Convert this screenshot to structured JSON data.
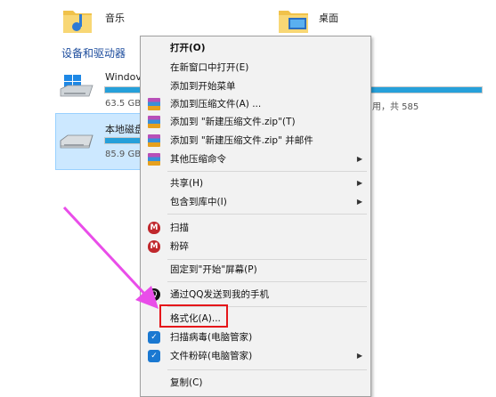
{
  "explorer": {
    "folders": [
      {
        "name": "音乐",
        "icon": "music-folder-icon"
      },
      {
        "name": "桌面",
        "icon": "desktop-folder-icon"
      }
    ],
    "section_title": "设备和驱动器",
    "drives": [
      {
        "name": "Windov",
        "size": "63.5 GB",
        "icon": "windows-drive-icon"
      },
      {
        "name": "本地磁盘",
        "size": "85.9 GB",
        "icon": "hard-drive-icon"
      }
    ],
    "partial_text": "用，共 585"
  },
  "context_menu": {
    "items": [
      {
        "label": "打开(O)",
        "bold": true
      },
      {
        "label": "在新窗口中打开(E)"
      },
      {
        "label": "添加到开始菜单"
      },
      {
        "label": "添加到压缩文件(A) ...",
        "icon": "winrar-icon"
      },
      {
        "label": "添加到 \"新建压缩文件.zip\"(T)",
        "icon": "winrar-icon"
      },
      {
        "label": "添加到 \"新建压缩文件.zip\" 并邮件",
        "icon": "winrar-icon"
      },
      {
        "label": "其他压缩命令",
        "icon": "winrar-icon",
        "submenu": true
      },
      {
        "label": "共享(H)",
        "submenu": true
      },
      {
        "label": "包含到库中(I)",
        "submenu": true
      },
      {
        "label": "扫描",
        "icon": "mcafee-icon"
      },
      {
        "label": "粉碎",
        "icon": "mcafee-icon"
      },
      {
        "label": "固定到\"开始\"屏幕(P)"
      },
      {
        "label": "通过QQ发送到我的手机",
        "icon": "qq-icon"
      },
      {
        "label": "格式化(A)..."
      },
      {
        "label": "扫描病毒(电脑管家)",
        "icon": "pc-manager-icon"
      },
      {
        "label": "文件粉碎(电脑管家)",
        "icon": "pc-manager-icon",
        "submenu": true
      },
      {
        "label": "复制(C)"
      }
    ]
  },
  "colors": {
    "accent": "#1f4e9e",
    "usage_bar": "#26a0da",
    "highlight_box": "#e5161a",
    "arrow": "#e94de9"
  }
}
